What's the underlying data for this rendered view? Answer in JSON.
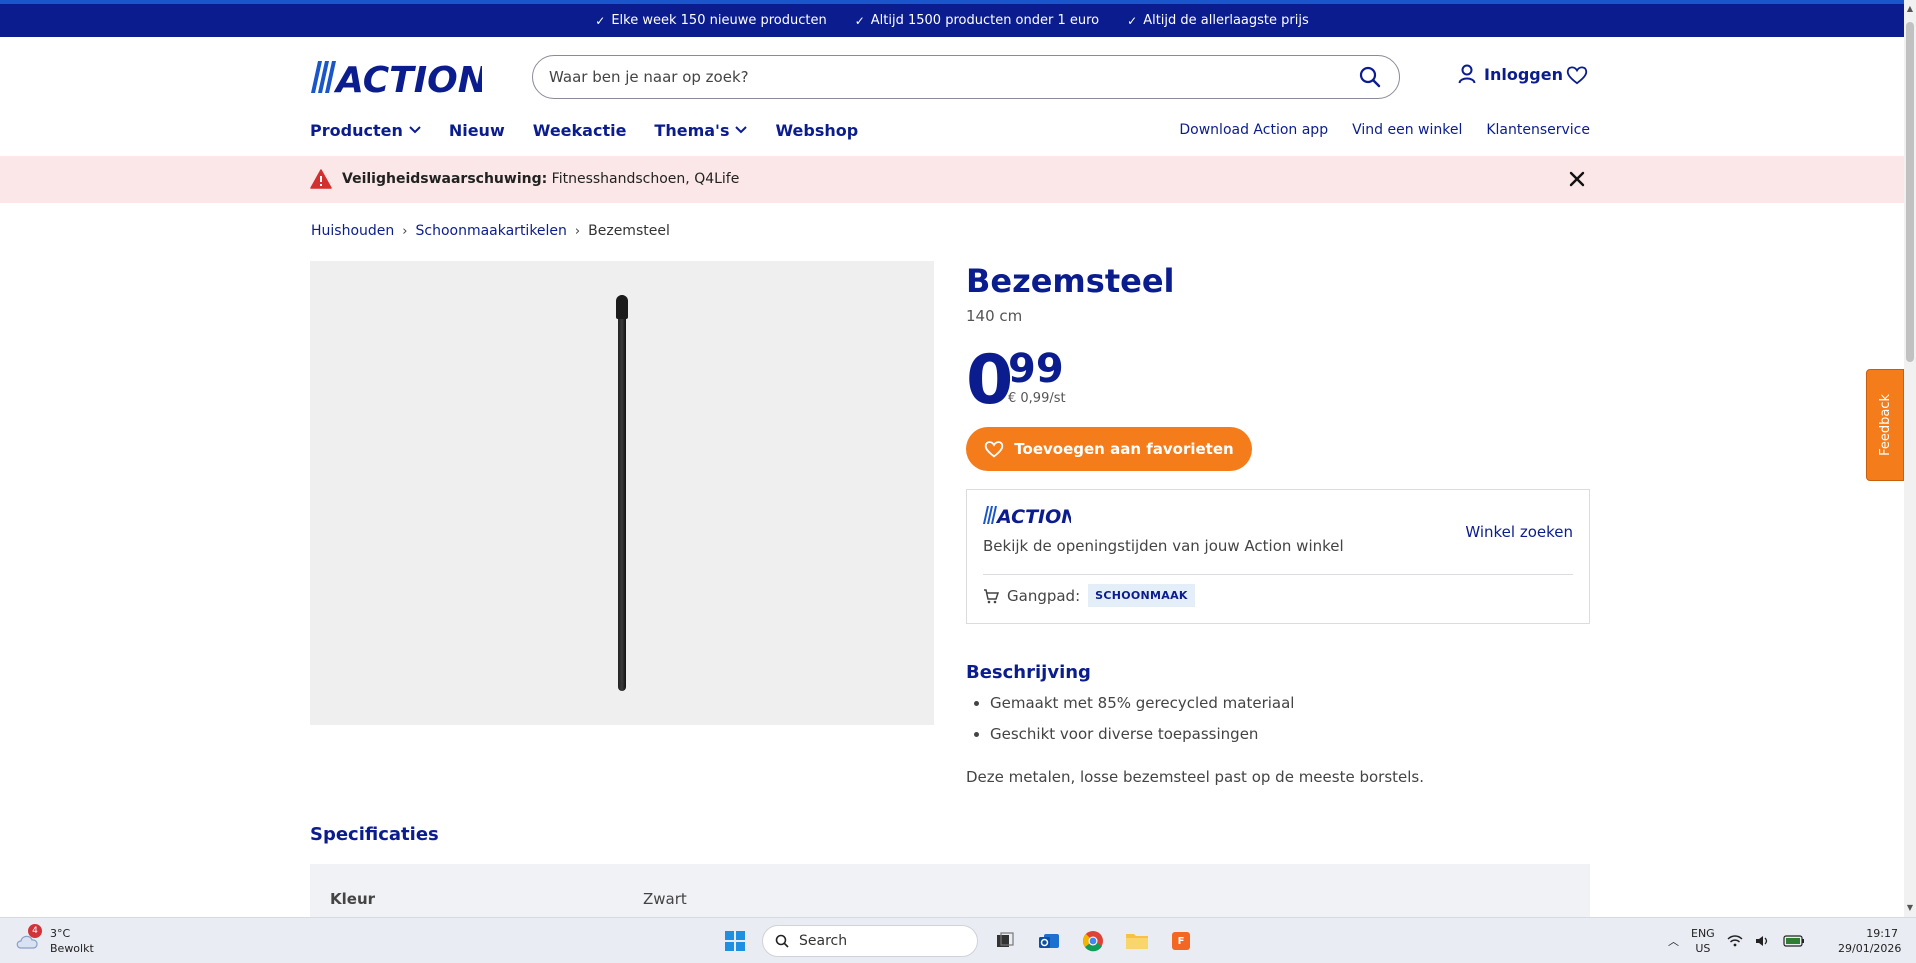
{
  "topbar": {
    "usps": [
      "Elke week 150 nieuwe producten",
      "Altijd 1500 producten onder 1 euro",
      "Altijd de allerlaagste prijs"
    ]
  },
  "header": {
    "logo_text": "ACTION",
    "search_placeholder": "Waar ben je naar op zoek?",
    "login_label": "Inloggen"
  },
  "nav": {
    "items": [
      "Producten",
      "Nieuw",
      "Weekactie",
      "Thema's",
      "Webshop"
    ],
    "right_links": [
      "Download Action app",
      "Vind een winkel",
      "Klantenservice"
    ]
  },
  "warning": {
    "label": "Veiligheidswaarschuwing:",
    "text": "Fitnesshandschoen, Q4Life"
  },
  "breadcrumb": {
    "items": [
      "Huishouden",
      "Schoonmaakartikelen"
    ],
    "current": "Bezemsteel"
  },
  "product": {
    "title": "Bezemsteel",
    "subtitle": "140 cm",
    "price_int": "0",
    "price_dec": "99",
    "unit_price": "€ 0,99/st",
    "fav_button": "Toevoegen aan favorieten"
  },
  "store": {
    "text": "Bekijk de openingstijden van jouw Action winkel",
    "link": "Winkel zoeken",
    "aisle_label": "Gangpad:",
    "aisle_value": "SCHOONMAAK"
  },
  "description": {
    "title": "Beschrijving",
    "bullets": [
      "Gemaakt met 85% gerecycled materiaal",
      "Geschikt voor diverse toepassingen"
    ],
    "text": "Deze metalen, losse bezemsteel past op de meeste borstels."
  },
  "specs": {
    "title": "Specificaties",
    "rows": [
      {
        "key": "Kleur",
        "value": "Zwart"
      }
    ]
  },
  "feedback": {
    "label": "Feedback"
  },
  "taskbar": {
    "weather_temp": "3°C",
    "weather_desc": "Bewolkt",
    "weather_badge": "4",
    "search_label": "Search",
    "lang_top": "ENG",
    "lang_bottom": "US",
    "time": "19:17",
    "date": "29/01/2026"
  },
  "colors": {
    "brand": "#0b1d8e",
    "accent": "#f47c1a",
    "warning_bg": "#fbe7e7"
  }
}
